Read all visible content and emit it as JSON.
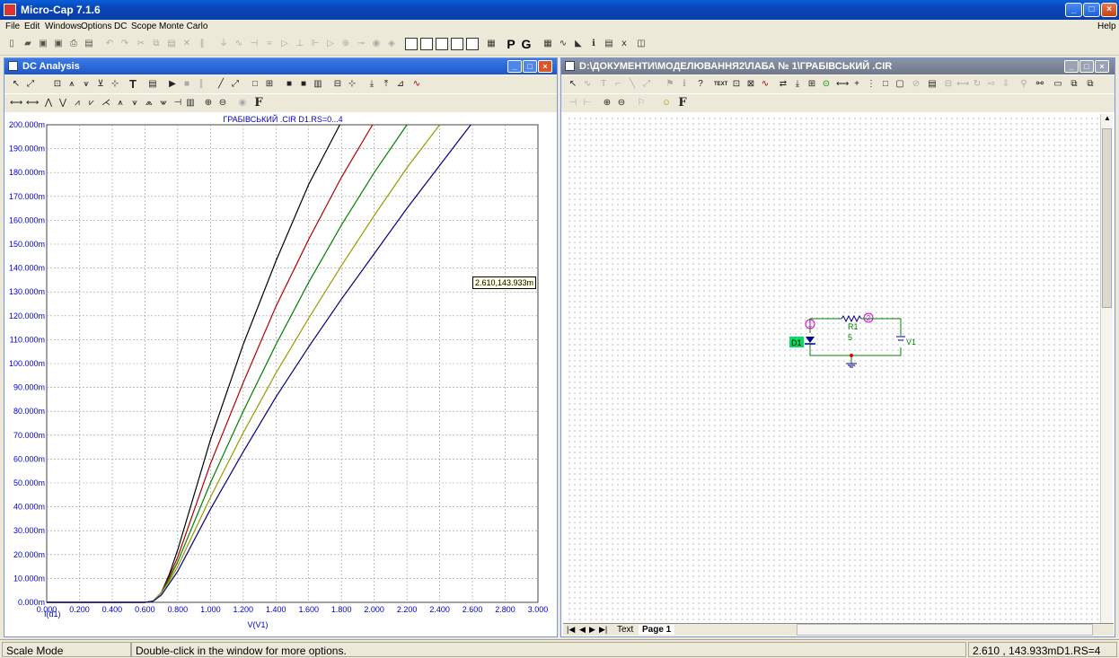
{
  "app": {
    "title": "Micro-Cap 7.1.6"
  },
  "menu": [
    "File",
    "Edit",
    "Windows",
    "Options",
    "DC",
    "Scope",
    "Monte Carlo"
  ],
  "menu_help": "Help",
  "toolbar": {
    "p": "P",
    "g": "G"
  },
  "dc_window": {
    "title": "DC Analysis",
    "tool_t": "T",
    "tool_f": "F"
  },
  "schematic_window": {
    "title": "D:\\ДОКУМЕНТИ\\МОДЕЛЮВАННЯ2\\ЛАБА № 1\\ГРАБІВСЬКИЙ .CIR",
    "tool_text": "TEXT",
    "tool_f": "F"
  },
  "schematic": {
    "d1": "D1",
    "r1": "R1",
    "r1_value": "5",
    "v1": "V1",
    "node1": "1",
    "node2": "2"
  },
  "tabs": {
    "text": "Text",
    "page1": "Page 1"
  },
  "tooltip": "2.610,143.933m",
  "status": {
    "mode": "Scale Mode",
    "hint": "Double-click in the window for more options.",
    "readout": "2.610 , 143.933mD1.RS=4"
  },
  "chart_data": {
    "type": "line",
    "title": "ГРАБІВСЬКИЙ .CIR D1.RS=0...4",
    "xlabel": "V(V1)",
    "ylabel": "I(d1)",
    "xlim": [
      0,
      3
    ],
    "ylim": [
      0,
      0.2
    ],
    "grid": true,
    "xticks": [
      "0.000",
      "0.200",
      "0.400",
      "0.600",
      "0.800",
      "1.000",
      "1.200",
      "1.400",
      "1.600",
      "1.800",
      "2.000",
      "2.200",
      "2.400",
      "2.600",
      "2.800",
      "3.000"
    ],
    "yticks": [
      "0.000m",
      "10.000m",
      "20.000m",
      "30.000m",
      "40.000m",
      "50.000m",
      "60.000m",
      "70.000m",
      "80.000m",
      "90.000m",
      "100.000m",
      "110.000m",
      "120.000m",
      "130.000m",
      "140.000m",
      "150.000m",
      "160.000m",
      "170.000m",
      "180.000m",
      "190.000m",
      "200.000m"
    ],
    "series": [
      {
        "color": "#000000",
        "x": [
          0,
          0.6,
          0.65,
          0.7,
          0.75,
          0.8,
          1.0,
          1.2,
          1.4,
          1.6,
          1.79
        ],
        "y": [
          0,
          0,
          0.0005,
          0.004,
          0.012,
          0.022,
          0.068,
          0.108,
          0.143,
          0.175,
          0.2
        ]
      },
      {
        "color": "#b00000",
        "x": [
          0,
          0.6,
          0.65,
          0.7,
          0.75,
          0.8,
          1.0,
          1.2,
          1.4,
          1.6,
          1.8,
          1.99
        ],
        "y": [
          0,
          0,
          0.0005,
          0.004,
          0.011,
          0.019,
          0.058,
          0.092,
          0.124,
          0.152,
          0.178,
          0.2
        ]
      },
      {
        "color": "#008000",
        "x": [
          0,
          0.6,
          0.65,
          0.7,
          0.75,
          0.8,
          1.0,
          1.2,
          1.4,
          1.6,
          1.8,
          2.0,
          2.2
        ],
        "y": [
          0,
          0,
          0.0005,
          0.004,
          0.01,
          0.017,
          0.05,
          0.08,
          0.108,
          0.134,
          0.158,
          0.18,
          0.2
        ]
      },
      {
        "color": "#999900",
        "x": [
          0,
          0.6,
          0.65,
          0.7,
          0.75,
          0.8,
          1.0,
          1.2,
          1.4,
          1.6,
          1.8,
          2.0,
          2.2,
          2.4
        ],
        "y": [
          0,
          0,
          0.0005,
          0.004,
          0.009,
          0.015,
          0.044,
          0.071,
          0.096,
          0.119,
          0.141,
          0.162,
          0.182,
          0.2
        ]
      },
      {
        "color": "#000080",
        "x": [
          0,
          0.6,
          0.65,
          0.7,
          0.75,
          0.8,
          1.0,
          1.2,
          1.4,
          1.6,
          1.8,
          2.0,
          2.2,
          2.4,
          2.59
        ],
        "y": [
          0,
          0,
          0.0005,
          0.003,
          0.008,
          0.013,
          0.039,
          0.063,
          0.086,
          0.107,
          0.127,
          0.146,
          0.165,
          0.183,
          0.2
        ]
      }
    ]
  }
}
